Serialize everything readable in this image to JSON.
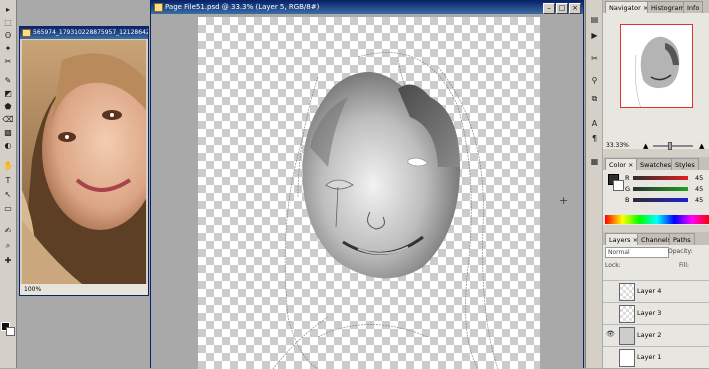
{
  "tools": {
    "items": [
      "▸",
      "⬚",
      "ʘ",
      "✦",
      "✂",
      "✎",
      "◩",
      "⬟",
      "⌫",
      "▩",
      "◐",
      "✋",
      "T",
      "↖",
      "▭",
      "✍",
      "⌕",
      "✚"
    ]
  },
  "photo_window": {
    "title": "565974_179310228875957_1212864234",
    "zoom": "100%"
  },
  "document_window": {
    "title": "Page File51.psd @ 33.3% (Layer 5, RGB/8#)",
    "btn_min": "–",
    "btn_max": "□",
    "btn_close": "×"
  },
  "navigator_panel": {
    "tabs": [
      "Navigator ×",
      "Histogram",
      "Info"
    ],
    "zoom": "33.33%"
  },
  "color_panel": {
    "tabs": [
      "Color ×",
      "Swatches",
      "Styles"
    ],
    "sliders": [
      {
        "label": "R",
        "value": "45",
        "color": "#e02020"
      },
      {
        "label": "G",
        "value": "45",
        "color": "#20a020"
      },
      {
        "label": "B",
        "value": "45",
        "color": "#2020d0"
      }
    ]
  },
  "layers_panel": {
    "tabs": [
      "Layers ×",
      "Channels",
      "Paths"
    ],
    "blend_mode": "Normal",
    "opacity_label": "Opacity:",
    "lock_label": "Lock:",
    "fill_label": "Fill:",
    "layers": [
      {
        "name": "Layer 4",
        "visible": false
      },
      {
        "name": "Layer 3",
        "visible": false
      },
      {
        "name": "Layer 2",
        "visible": true
      },
      {
        "name": "Layer 1",
        "visible": false
      }
    ]
  },
  "colors": {
    "titlebar_start": "#0a246a",
    "titlebar_end": "#3a6ea5",
    "navigator_frame": "#e03030"
  }
}
